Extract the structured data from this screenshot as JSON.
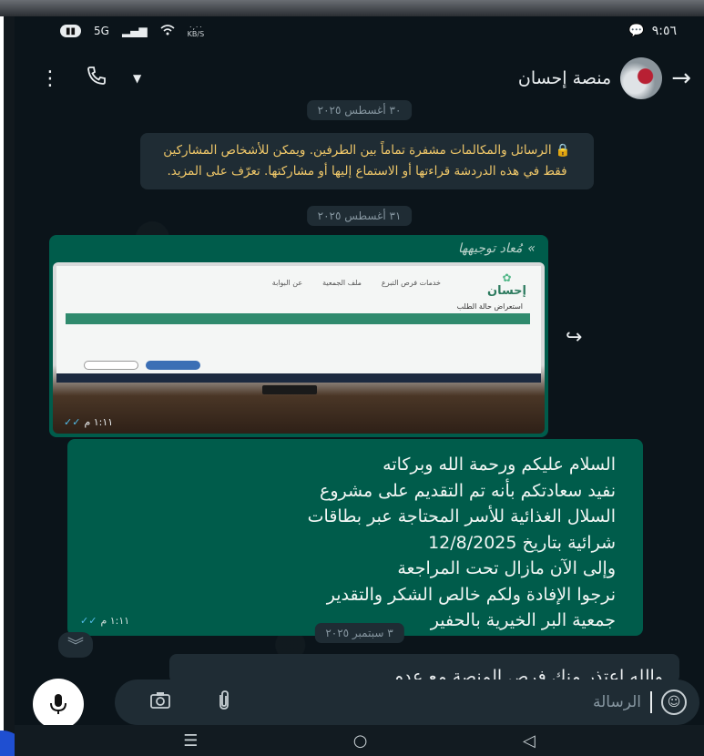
{
  "status_bar": {
    "time": "٩:٥٦",
    "network": "5G",
    "speed_value": "٠,٠٠",
    "speed_unit": "KB/S"
  },
  "header": {
    "contact_name": "منصة إحسان"
  },
  "chat": {
    "date_1": "٣٠ أغسطس ٢٠٢٥",
    "encryption_note": "الرسائل والمكالمات مشفرة تماماً بين الطرفين. ويمكن للأشخاص المشاركين فقط في هذه الدردشة قراءتها أو الاستماع إليها أو مشاركتها. تعرّف على المزيد.",
    "date_2": "٣١ أغسطس ٢٠٢٥",
    "image_message": {
      "forwarded_label": "مُعاد توجيهها",
      "time": "١:١١ م",
      "webpage": {
        "logo_text": "إحسان",
        "nav_1": "خدمات فرص التبرع",
        "nav_2": "ملف الجمعية",
        "nav_3": "عن البوابة",
        "page_title": "استعراض حالة الطلب"
      }
    },
    "text_message": {
      "lines": [
        "السلام عليكم ورحمة الله وبركاته",
        "نفيد سعادتكم بأنه تم التقديم على مشروع",
        "السلال الغذائية للأسر المحتاجة عبر بطاقات",
        "شرائية بتاريخ 12/8/2025",
        "وإلى الآن مازال تحت المراجعة",
        "نرجوا الإفادة ولكم خالص الشكر والتقدير",
        "جمعية البر الخيرية بالحفير"
      ],
      "time": "١:١١ م"
    },
    "date_3": "٣ سبتمبر ٢٠٢٥",
    "partial_message": "والله اعتذر منك فرص المنصة مع عدم"
  },
  "input": {
    "placeholder": "الرسالة"
  },
  "colors": {
    "background": "#0b141a",
    "outgoing_bubble": "#005c4b",
    "incoming_bubble": "#1f2c34",
    "system_note_text": "#f0c869",
    "read_ticks": "#53bdeb"
  }
}
